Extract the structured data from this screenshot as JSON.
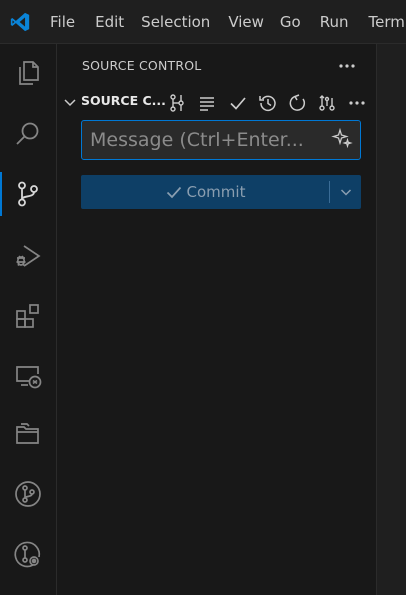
{
  "menu": [
    "File",
    "Edit",
    "Selection",
    "View",
    "Go",
    "Run",
    "Term"
  ],
  "sidebar": {
    "title": "SOURCE CONTROL",
    "section_title": "SOURCE C...",
    "message_placeholder": "Message (Ctrl+Enter...",
    "commit_label": "Commit"
  },
  "activity_bar": [
    "files-icon",
    "search-icon",
    "source-control-icon",
    "run-debug-icon",
    "extensions-icon",
    "remote-explorer-icon",
    "folder-icon",
    "git-graph-icon",
    "git-history-icon"
  ],
  "colors": {
    "accent": "#0078d4",
    "commit_button": "#0e3f66",
    "sidebar_bg": "#181818",
    "titlebar_bg": "#1f1f1f"
  }
}
